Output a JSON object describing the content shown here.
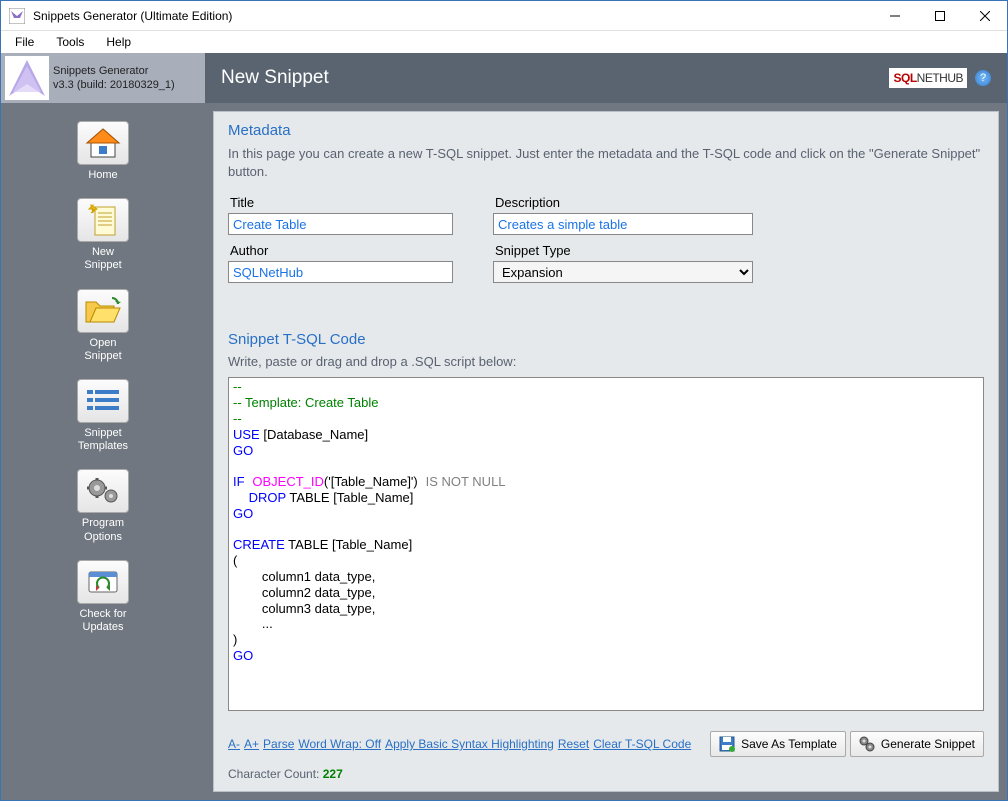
{
  "window": {
    "title": "Snippets Generator (Ultimate Edition)"
  },
  "menubar": [
    "File",
    "Tools",
    "Help"
  ],
  "app": {
    "name": "Snippets Generator",
    "version": "v3.3 (build: 20180329_1)"
  },
  "sidebar": {
    "items": [
      {
        "label": "Home",
        "icon": "home"
      },
      {
        "label": "New\nSnippet",
        "icon": "newdoc"
      },
      {
        "label": "Open\nSnippet",
        "icon": "folder"
      },
      {
        "label": "Snippet\nTemplates",
        "icon": "templates"
      },
      {
        "label": "Program\nOptions",
        "icon": "gears"
      },
      {
        "label": "Check for\nUpdates",
        "icon": "updates"
      }
    ]
  },
  "page": {
    "title": "New Snippet",
    "brand_hub": "HUB"
  },
  "metadata": {
    "section_title": "Metadata",
    "instructions": "In this page you can create a new T-SQL snippet. Just enter the metadata and the T-SQL code and click on the \"Generate Snippet\" button.",
    "title_label": "Title",
    "title_value": "Create Table",
    "description_label": "Description",
    "description_value": "Creates a simple table",
    "author_label": "Author",
    "author_value": "SQLNetHub",
    "type_label": "Snippet Type",
    "type_value": "Expansion"
  },
  "code": {
    "section_title": "Snippet T-SQL Code",
    "instructions": "Write, paste or drag and drop a .SQL script below:",
    "lines": {
      "c1": "--",
      "c2": "-- Template: Create Table",
      "c3": "--",
      "use_kw": "USE",
      "use_arg": " [Database_Name]",
      "go": "GO",
      "if_kw": "IF",
      "objid": "OBJECT_ID",
      "objid_arg": "('[Table_Name]')",
      "isnotnull": "IS NOT NULL",
      "drop_kw": "DROP",
      "drop_rest": " TABLE [Table_Name]",
      "create_kw": "CREATE",
      "create_rest": " TABLE [Table_Name]",
      "paren_open": "(",
      "col1": "        column1 data_type,",
      "col2": "        column2 data_type,",
      "col3": "        column3 data_type,",
      "dots": "        ...",
      "paren_close": ")"
    }
  },
  "footer": {
    "links": [
      "A-",
      "A+",
      "Parse",
      "Word Wrap: Off",
      "Apply Basic Syntax Highlighting",
      "Reset",
      "Clear T-SQL Code"
    ],
    "save_template": "Save As Template",
    "generate": "Generate Snippet",
    "char_label": "Character Count:  ",
    "char_count": "227"
  }
}
